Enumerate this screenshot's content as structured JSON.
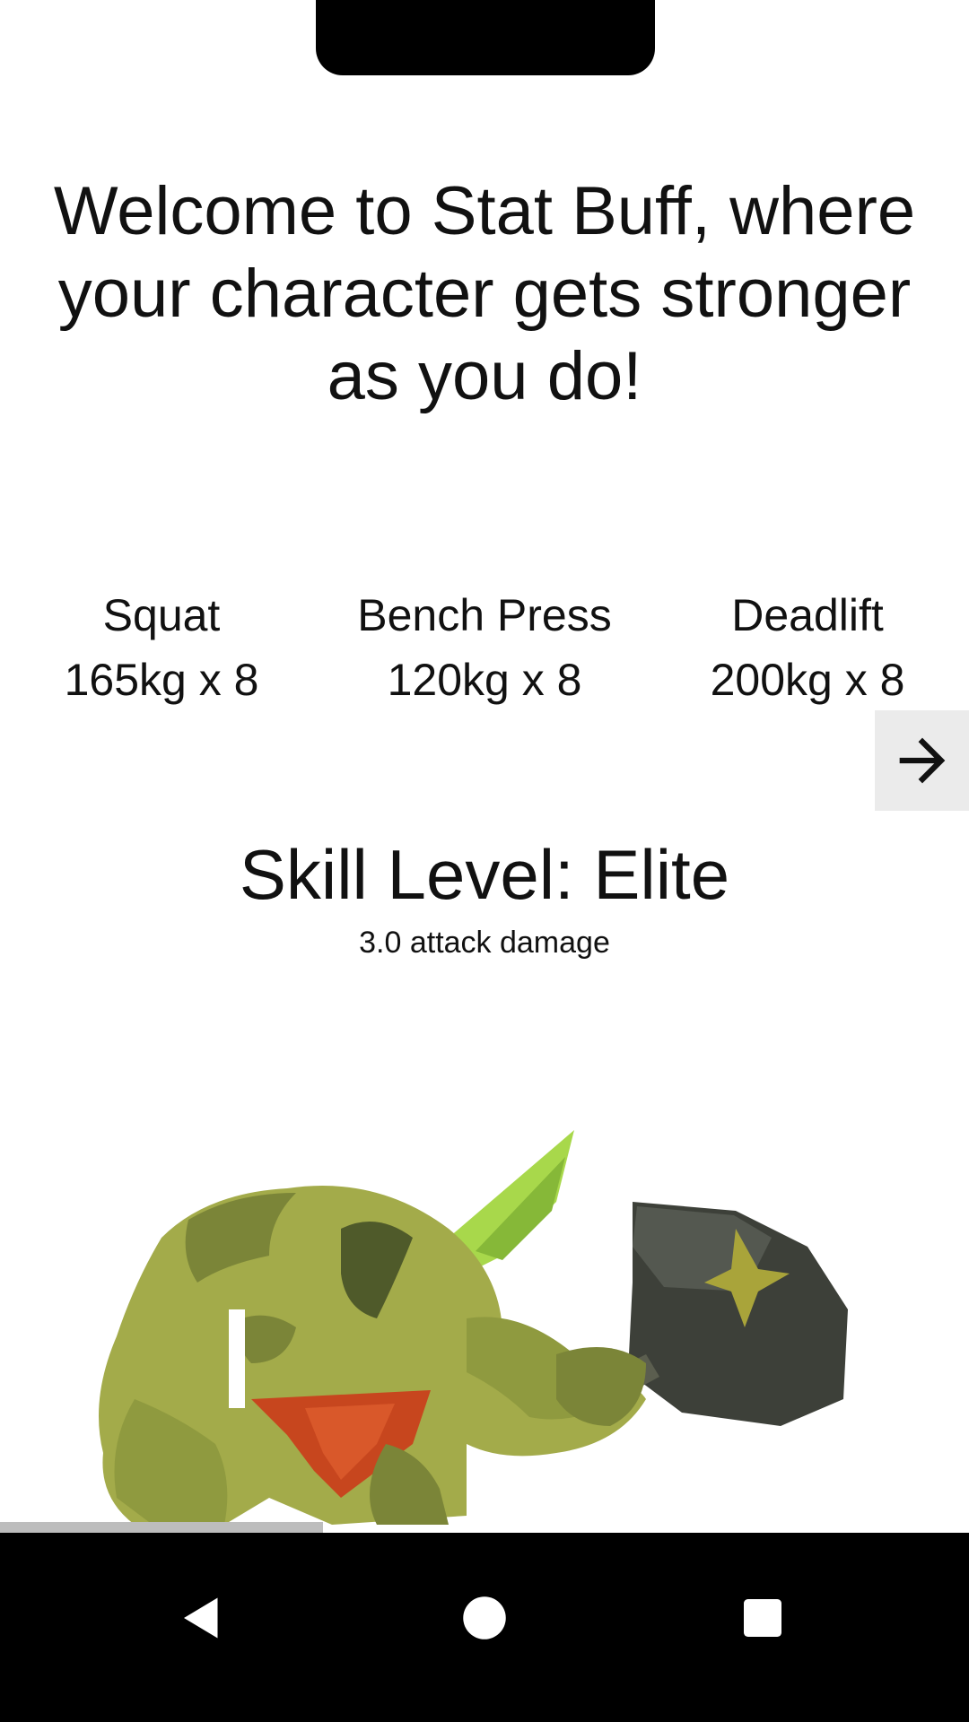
{
  "welcome": {
    "line1": "Welcome to Stat Buff, where",
    "line2": "your character gets stronger",
    "line3": "as you do!"
  },
  "stats": [
    {
      "name": "Squat",
      "value": "165kg x 8"
    },
    {
      "name": "Bench Press",
      "value": "120kg x 8"
    },
    {
      "name": "Deadlift",
      "value": "200kg x 8"
    }
  ],
  "next_button": {
    "icon": "arrow-right-icon"
  },
  "skill": {
    "title": "Skill Level: Elite",
    "damage": "3.0 attack damage"
  },
  "character": {
    "icon": "ogre-warrior-sprite"
  },
  "navbar": {
    "back_icon": "back-triangle-icon",
    "home_icon": "home-circle-icon",
    "recents_icon": "recents-square-icon"
  },
  "colors": {
    "ogre_skin": "#a3ab4a",
    "ogre_dark": "#4f5a2a",
    "loincloth": "#c7461e",
    "hammer": "#3d4039",
    "horn": "#a8d84b"
  }
}
